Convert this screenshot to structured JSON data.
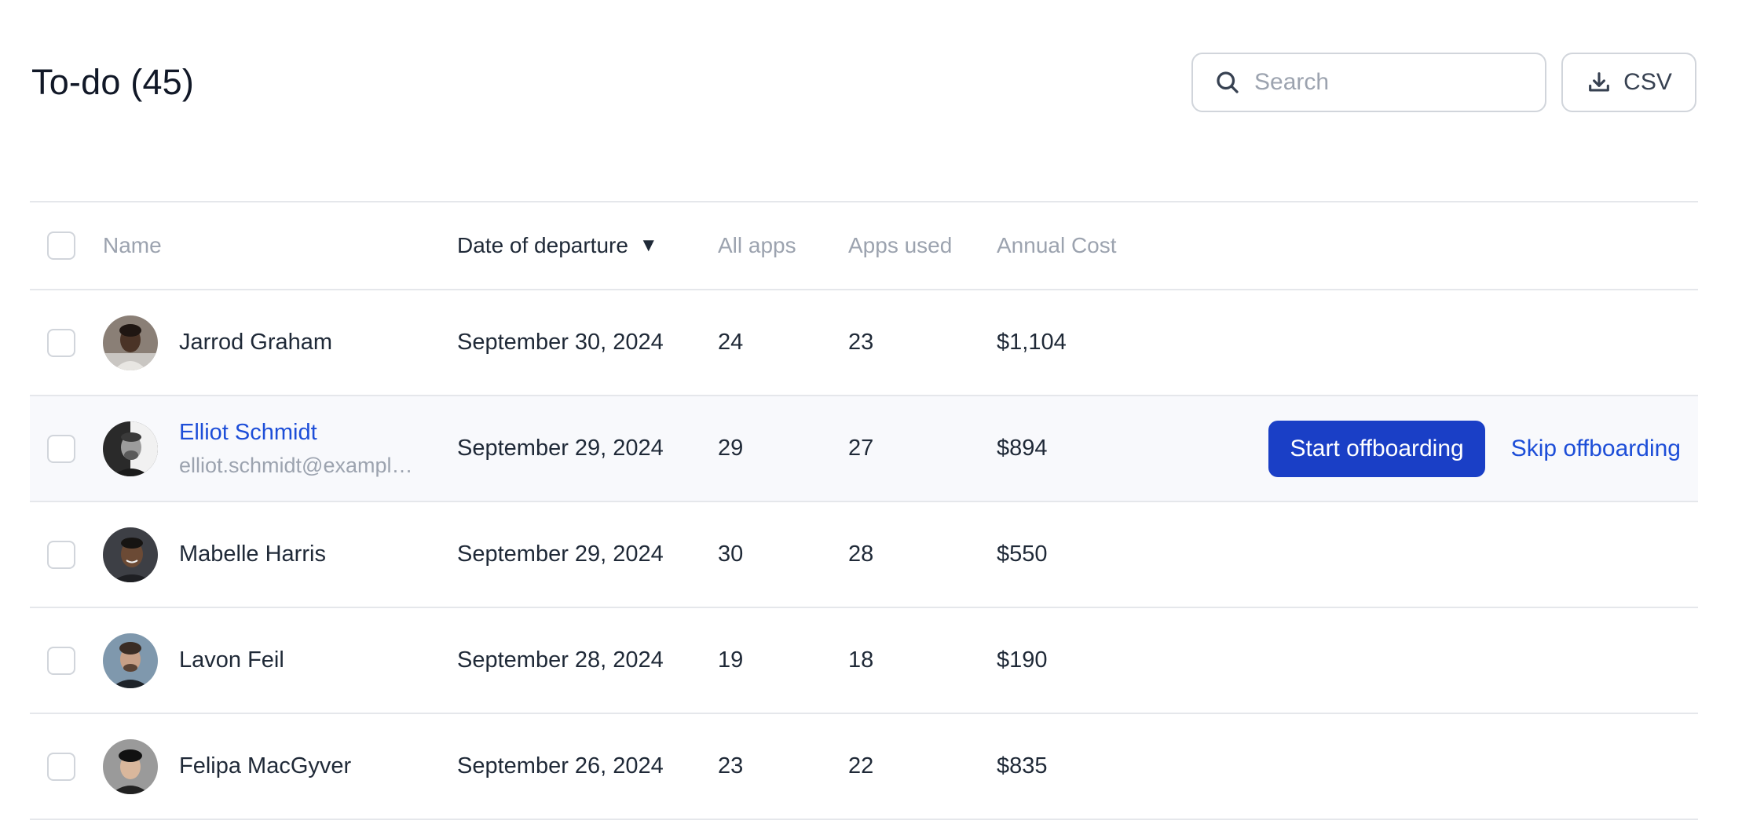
{
  "header": {
    "title": "To-do (45)",
    "search_placeholder": "Search",
    "search_value": "",
    "csv_label": "CSV"
  },
  "table": {
    "columns": {
      "name": "Name",
      "date": "Date of departure",
      "date_sort": "▼",
      "all_apps": "All apps",
      "apps_used": "Apps used",
      "annual_cost": "Annual Cost"
    },
    "rows": [
      {
        "name": "Jarrod Graham",
        "email": "",
        "date": "September 30, 2024",
        "all_apps": "24",
        "apps_used": "23",
        "cost": "$1,104"
      },
      {
        "name": "Elliot Schmidt",
        "email": "elliot.schmidt@example.com",
        "date": "September 29, 2024",
        "all_apps": "29",
        "apps_used": "27",
        "cost": "$894",
        "actions": {
          "start": "Start offboarding",
          "skip": "Skip offboarding"
        }
      },
      {
        "name": "Mabelle Harris",
        "email": "",
        "date": "September 29, 2024",
        "all_apps": "30",
        "apps_used": "28",
        "cost": "$550"
      },
      {
        "name": "Lavon Feil",
        "email": "",
        "date": "September 28, 2024",
        "all_apps": "19",
        "apps_used": "18",
        "cost": "$190"
      },
      {
        "name": "Felipa MacGyver",
        "email": "",
        "date": "September 26, 2024",
        "all_apps": "23",
        "apps_used": "22",
        "cost": "$835"
      }
    ]
  },
  "colors": {
    "primary": "#1a3fc6",
    "link": "#1d4ed8",
    "highlight_row": "#f8f9fc",
    "border": "#e5e7eb"
  },
  "icons": {
    "search": "search-icon",
    "download": "download-icon"
  }
}
